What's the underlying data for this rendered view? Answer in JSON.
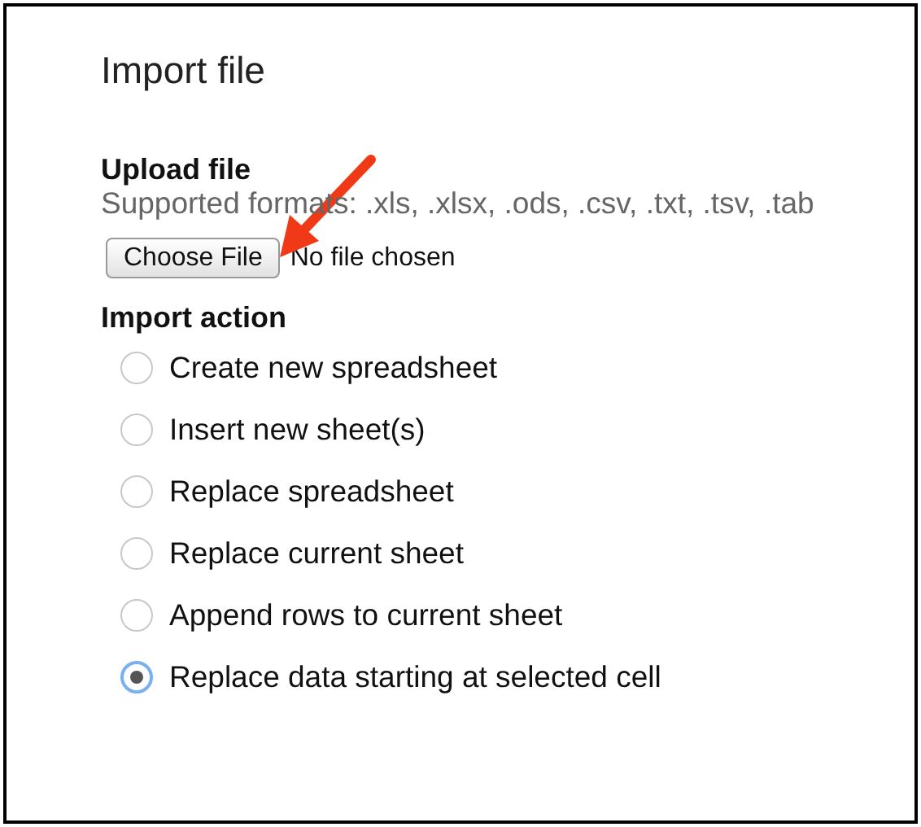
{
  "dialog": {
    "title": "Import file"
  },
  "upload": {
    "heading": "Upload file",
    "supported_formats": "Supported formats: .xls, .xlsx, .ods, .csv, .txt, .tsv, .tab",
    "button": "Choose File",
    "status": "No file chosen"
  },
  "import_action": {
    "heading": "Import action",
    "options": [
      {
        "label": "Create new spreadsheet",
        "selected": false
      },
      {
        "label": "Insert new sheet(s)",
        "selected": false
      },
      {
        "label": "Replace spreadsheet",
        "selected": false
      },
      {
        "label": "Replace current sheet",
        "selected": false
      },
      {
        "label": "Append rows to current sheet",
        "selected": false
      },
      {
        "label": "Replace data starting at selected cell",
        "selected": true
      }
    ]
  }
}
